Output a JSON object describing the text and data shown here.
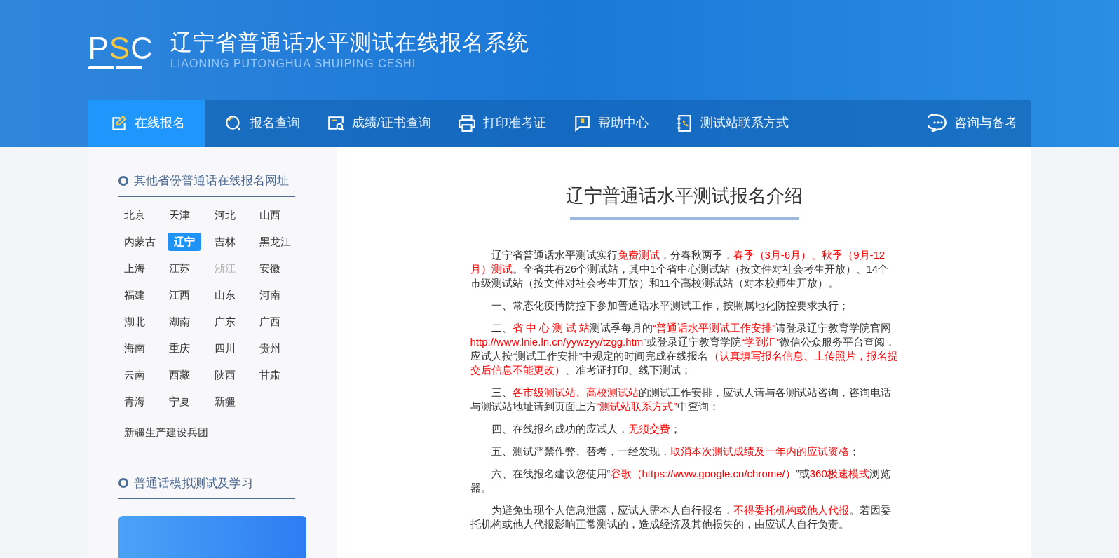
{
  "header": {
    "logo": [
      {
        "text": "P",
        "accent": false
      },
      {
        "text": "S",
        "accent": true
      },
      {
        "text": "C",
        "accent": false
      }
    ],
    "title": "辽宁省普通话水平测试在线报名系统",
    "subtitle": "LIAONING PUTONGHUA SHUIPING CESHI"
  },
  "nav": {
    "items": [
      {
        "label": "在线报名",
        "selected": true
      },
      {
        "label": "报名查询",
        "selected": false
      },
      {
        "label": "成绩/证书查询",
        "selected": false
      },
      {
        "label": "打印准考证",
        "selected": false
      },
      {
        "label": "帮助中心",
        "selected": false
      },
      {
        "label": "测试站联系方式",
        "selected": false
      }
    ],
    "right": {
      "label": "咨询与备考"
    }
  },
  "sidebar": {
    "provinces_heading": "其他省份普通话在线报名网址",
    "provinces": [
      {
        "name": "北京",
        "selected": false,
        "disabled": false
      },
      {
        "name": "天津",
        "selected": false,
        "disabled": false
      },
      {
        "name": "河北",
        "selected": false,
        "disabled": false
      },
      {
        "name": "山西",
        "selected": false,
        "disabled": false
      },
      {
        "name": "内蒙古",
        "selected": false,
        "disabled": false
      },
      {
        "name": "辽宁",
        "selected": true,
        "disabled": false
      },
      {
        "name": "吉林",
        "selected": false,
        "disabled": false
      },
      {
        "name": "黑龙江",
        "selected": false,
        "disabled": false
      },
      {
        "name": "上海",
        "selected": false,
        "disabled": false
      },
      {
        "name": "江苏",
        "selected": false,
        "disabled": false
      },
      {
        "name": "浙江",
        "selected": false,
        "disabled": true
      },
      {
        "name": "安徽",
        "selected": false,
        "disabled": false
      },
      {
        "name": "福建",
        "selected": false,
        "disabled": false
      },
      {
        "name": "江西",
        "selected": false,
        "disabled": false
      },
      {
        "name": "山东",
        "selected": false,
        "disabled": false
      },
      {
        "name": "河南",
        "selected": false,
        "disabled": false
      },
      {
        "name": "湖北",
        "selected": false,
        "disabled": false
      },
      {
        "name": "湖南",
        "selected": false,
        "disabled": false
      },
      {
        "name": "广东",
        "selected": false,
        "disabled": false
      },
      {
        "name": "广西",
        "selected": false,
        "disabled": false
      },
      {
        "name": "海南",
        "selected": false,
        "disabled": false
      },
      {
        "name": "重庆",
        "selected": false,
        "disabled": false
      },
      {
        "name": "四川",
        "selected": false,
        "disabled": false
      },
      {
        "name": "贵州",
        "selected": false,
        "disabled": false
      },
      {
        "name": "云南",
        "selected": false,
        "disabled": false
      },
      {
        "name": "西藏",
        "selected": false,
        "disabled": false
      },
      {
        "name": "陕西",
        "selected": false,
        "disabled": false
      },
      {
        "name": "甘肃",
        "selected": false,
        "disabled": false
      },
      {
        "name": "青海",
        "selected": false,
        "disabled": false
      },
      {
        "name": "宁夏",
        "selected": false,
        "disabled": false
      },
      {
        "name": "新疆",
        "selected": false,
        "disabled": false
      }
    ],
    "extra_link": "新疆生产建设兵团",
    "study_heading": "普通话模拟测试及学习"
  },
  "article": {
    "title": "辽宁普通话水平测试报名介绍",
    "paragraphs": [
      [
        {
          "text": "辽宁省普通话水平测试实行",
          "highlight": false
        },
        {
          "text": "免费测试",
          "highlight": true
        },
        {
          "text": "，分春秋两季，",
          "highlight": false
        },
        {
          "text": "春季（3月-6月）、秋季（9月-12月）测试",
          "highlight": true
        },
        {
          "text": "。全省共有26个测试站，其中1个省中心测试站（按文件对社会考生开放）、14个市级测试站（按文件对社会考生开放）和11个高校测试站（对本校师生开放）。",
          "highlight": false
        }
      ],
      [
        {
          "text": "一、常态化疫情防控下参加普通话水平测试工作，按照属地化防控要求执行；",
          "highlight": false
        }
      ],
      [
        {
          "text": "二、",
          "highlight": false
        },
        {
          "text": "省 中 心 测 试 站",
          "highlight": true
        },
        {
          "text": "测试季每月的",
          "highlight": false
        },
        {
          "text": "“普通话水平测试工作安排”",
          "highlight": true
        },
        {
          "text": "请登录辽宁教育学院官网",
          "highlight": false
        },
        {
          "text": "http://www.lnie.ln.cn/yywzyy/tzgg.htm",
          "highlight": true
        },
        {
          "text": "”或登录辽宁教育学院",
          "highlight": false
        },
        {
          "text": "“学到汇”",
          "highlight": true
        },
        {
          "text": "微信公众服务平台查阅，应试人按“测试工作安排”中规定的时间完成在线报名",
          "highlight": false
        },
        {
          "text": "（认真填写报名信息、上传照片，报名提交后信息不能更改）",
          "highlight": true
        },
        {
          "text": "、准考证打印、线下测试；",
          "highlight": false
        }
      ],
      [
        {
          "text": "三、",
          "highlight": false
        },
        {
          "text": "各市级测试站、高校测试站",
          "highlight": true
        },
        {
          "text": "的测试工作安排，应试人请与各测试站咨询，咨询电话与测试站地址请到页面上方",
          "highlight": false
        },
        {
          "text": "“测试站联系方式”",
          "highlight": true
        },
        {
          "text": "中查询；",
          "highlight": false
        }
      ],
      [
        {
          "text": "四、在线报名成功的应试人，",
          "highlight": false
        },
        {
          "text": "无须交费",
          "highlight": true
        },
        {
          "text": "；",
          "highlight": false
        }
      ],
      [
        {
          "text": "五、测试严禁作弊、替考，一经发现，",
          "highlight": false
        },
        {
          "text": "取消本次测试成绩及一年内的应试资格",
          "highlight": true
        },
        {
          "text": "；",
          "highlight": false
        }
      ],
      [
        {
          "text": "六、在线报名建议您使用“",
          "highlight": false
        },
        {
          "text": "谷歌（https://www.google.cn/chrome/）",
          "highlight": true
        },
        {
          "text": "”或",
          "highlight": false
        },
        {
          "text": "360极速模式",
          "highlight": true
        },
        {
          "text": "浏览器。",
          "highlight": false
        }
      ],
      [
        {
          "text": "为避免出现个人信息泄露，应试人需本人自行报名，",
          "highlight": false
        },
        {
          "text": "不得委托机构或他人代报",
          "highlight": true
        },
        {
          "text": "。若因委托机构或他人代报影响正常测试的，造成经济及其他损失的，由应试人自行负责。",
          "highlight": false
        }
      ]
    ]
  }
}
